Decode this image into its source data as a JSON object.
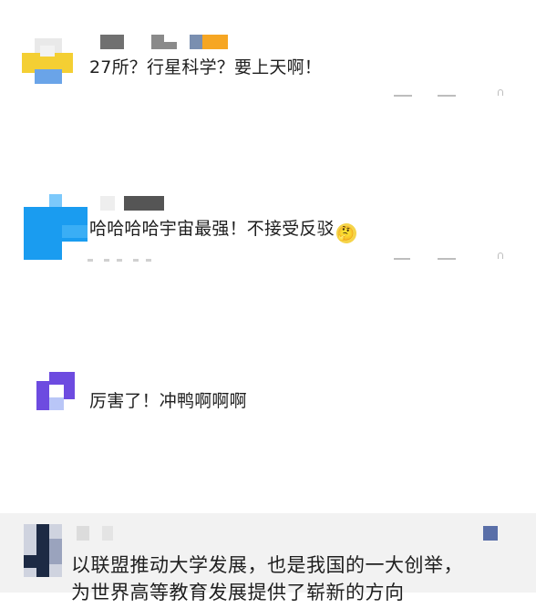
{
  "comments": [
    {
      "text": "27所？行星科学？要上天啊！",
      "avatar_colors": [
        "#f4cf33",
        "#6aa4e8",
        "#e8d23b",
        "#c9c9c9"
      ],
      "name_colors": [
        "#707070",
        "#8a8a8a",
        "#f6a623"
      ]
    },
    {
      "text": "哈哈哈哈宇宙最强！不接受反驳",
      "emoji": "🤔",
      "avatar_colors": [
        "#1a9cf0",
        "#3aaef5",
        "#7cc9fb"
      ],
      "name_colors": [
        "#e6e6e6",
        "#555555"
      ]
    },
    {
      "text": "厉害了！冲鸭啊啊啊",
      "avatar_colors": [
        "#6d4be0",
        "#8f7cf0",
        "#b9c6f7"
      ],
      "name_colors": []
    }
  ],
  "featured": {
    "line1": "以联盟推动大学发展，也是我国的一大创举，",
    "line2": "为世界高等教育发展提供了崭新的方向",
    "avatar_colors": [
      "#1d2a44",
      "#cfd3df",
      "#9aa3bd"
    ],
    "badge_color": "#5a6fa8"
  },
  "colors": {
    "background": "#ffffff",
    "highlight_background": "#f2f2f2",
    "text": "#1f1f1f",
    "action_icon": "#bdbdbd"
  }
}
